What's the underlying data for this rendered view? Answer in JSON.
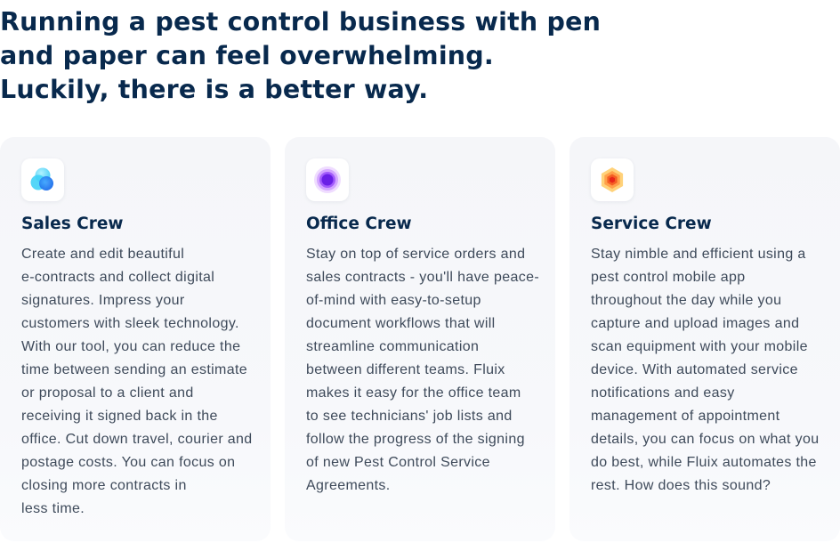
{
  "headline": {
    "lines": [
      "Running a pest control business with pen",
      "and paper can feel overwhelming.",
      "Luckily, there is a better way."
    ]
  },
  "cards": [
    {
      "icon": "blue-overlapping-circles-icon",
      "title": "Sales Crew",
      "body_lines": [
        "Create and edit beautiful",
        "e-contracts and collect digital",
        "signatures. Impress your",
        "customers with sleek technology.",
        "With our tool, you can reduce the",
        "time between sending an estimate",
        "or proposal to a client and",
        "receiving it signed back in the",
        "office. Cut down travel, courier and",
        "postage costs. You can focus on",
        "closing more contracts in",
        "less time."
      ]
    },
    {
      "icon": "purple-concentric-circles-icon",
      "title": "Office Crew",
      "body_lines": [
        "Stay on top of service orders and",
        "sales contracts - you'll have peace-",
        "of-mind with easy-to-setup",
        "document workflows that will",
        "streamline communication",
        "between different teams. Fluix",
        "makes it easy for the office team",
        "to see technicians' job lists and",
        "follow the progress of the signing",
        "of new Pest Control Service",
        "Agreements."
      ]
    },
    {
      "icon": "orange-concentric-hexagons-icon",
      "title": "Service Crew",
      "body_lines": [
        "Stay nimble and efficient using a",
        "pest control mobile app",
        "throughout the day while you",
        "capture and upload images and",
        "scan equipment with your mobile",
        "device. With automated service",
        "notifications and easy",
        "management of appointment",
        "details, you can focus on what you",
        "do best, while Fluix automates the",
        "rest. How does this sound?"
      ]
    }
  ],
  "colors": {
    "heading": "#08294d",
    "body_text": "#3e4a5a",
    "card_background": "#f5f6f9",
    "sales_icon": "#1f8ef5",
    "office_icon": "#7b2ff0",
    "service_icon": "#f05a1e"
  }
}
